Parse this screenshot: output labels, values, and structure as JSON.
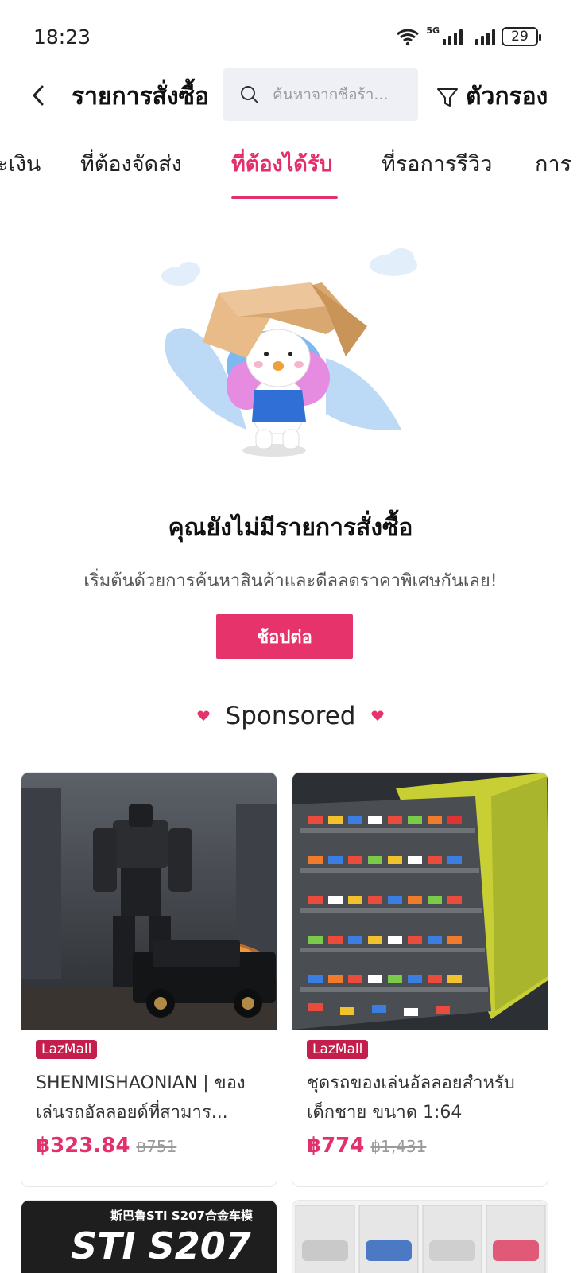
{
  "status_bar": {
    "time": "18:23",
    "network": "5G",
    "battery": "29",
    "icons": [
      "wifi-icon",
      "signal-icon",
      "signal-icon",
      "battery-icon"
    ]
  },
  "header": {
    "back_icon": "chevron-left-icon",
    "title": "รายการสั่งซื้อ",
    "search_placeholder": "ค้นหาจากชื่อร้า...",
    "filter_label": "ตัวกรอง",
    "filter_icon": "funnel-icon"
  },
  "tabs": [
    {
      "label": "ะเงิน",
      "active": false
    },
    {
      "label": "ที่ต้องจัดส่ง",
      "active": false
    },
    {
      "label": "ที่ต้องได้รับ",
      "active": true
    },
    {
      "label": "ที่รอการรีวิว",
      "active": false
    },
    {
      "label": "การ",
      "active": false
    }
  ],
  "empty_state": {
    "title": "คุณยังไม่มีรายการสั่งซื้อ",
    "subtitle": "เริ่มต้นด้วยการค้นหาสินค้าและดีลลดราคาพิเศษกันเลย!",
    "button_label": "ช้อปต่อ"
  },
  "sponsored": {
    "label": "Sponsored"
  },
  "products": [
    {
      "badge": "LazMall",
      "title": "SHENMISHAONIAN | ของเล่นรถอัลลอยด์ที่สามาร...",
      "price": "฿323.84",
      "old_price": "฿751"
    },
    {
      "badge": "LazMall",
      "title": "ชุดรถของเล่นอัลลอยสำหรับเด็กชาย ขนาด 1:64",
      "price": "฿774",
      "old_price": "฿1,431"
    }
  ],
  "next_product_text": "斯巴鲁STI S207合金车模",
  "next_product_logo_text": "STI S207",
  "colors": {
    "accent": "#e1306c",
    "button": "#e6336b",
    "lazmall": "#c41f4c",
    "search_bg": "#eff0f5"
  }
}
